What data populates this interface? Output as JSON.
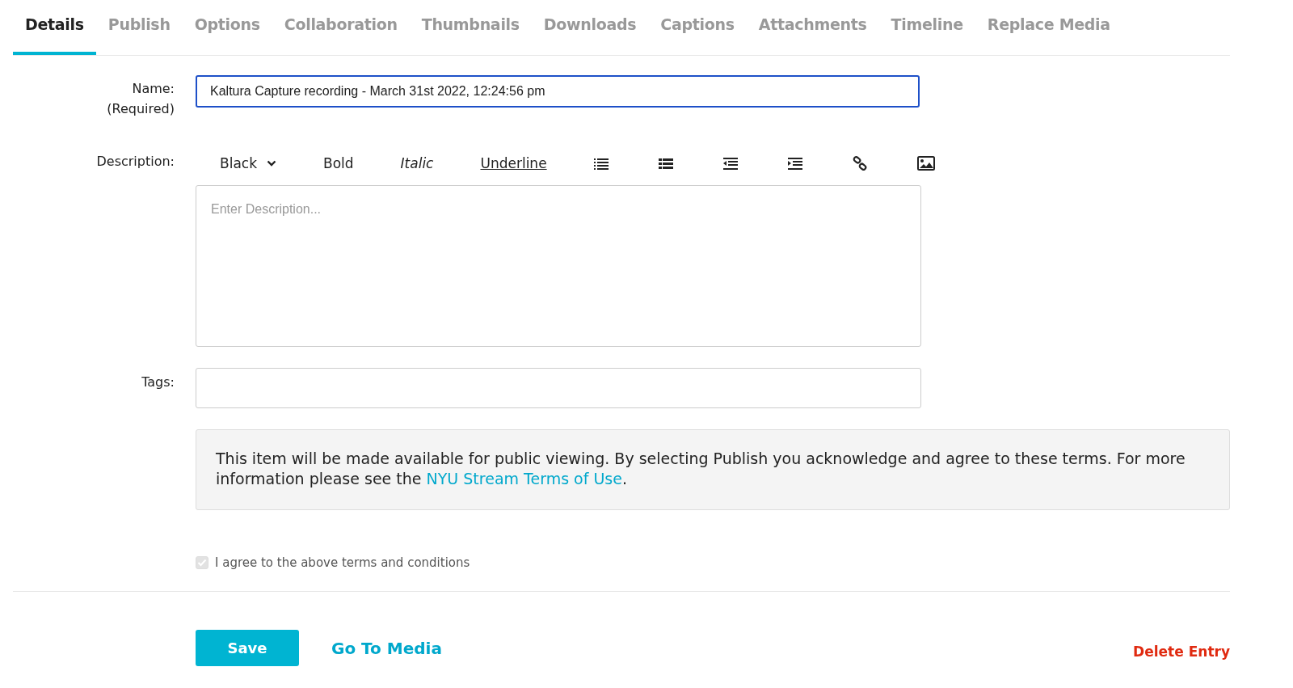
{
  "tabs": [
    {
      "label": "Details",
      "selected": true
    },
    {
      "label": "Publish",
      "selected": false
    },
    {
      "label": "Options",
      "selected": false
    },
    {
      "label": "Collaboration",
      "selected": false
    },
    {
      "label": "Thumbnails",
      "selected": false
    },
    {
      "label": "Downloads",
      "selected": false
    },
    {
      "label": "Captions",
      "selected": false
    },
    {
      "label": "Attachments",
      "selected": false
    },
    {
      "label": "Timeline",
      "selected": false
    },
    {
      "label": "Replace Media",
      "selected": false
    }
  ],
  "name_field": {
    "label": "Name:",
    "required": "(Required)",
    "value": "Kaltura Capture recording - March 31st 2022, 12:24:56 pm"
  },
  "description": {
    "label": "Description:",
    "placeholder": "Enter Description...",
    "toolbar": [
      {
        "kind": "color",
        "label": "Black"
      },
      {
        "kind": "bold",
        "label": "Bold"
      },
      {
        "kind": "italic",
        "label": "Italic"
      },
      {
        "kind": "underline",
        "label": "Underline"
      }
    ]
  },
  "tags": {
    "label": "Tags:"
  },
  "notice": {
    "text": "This item will be made available for public viewing. By selecting Publish you acknowledge and agree to these terms. For more information please see the ",
    "link": "NYU Stream Terms of Use",
    "after": "."
  },
  "agree": {
    "label": "I agree to the above terms and conditions",
    "checked": true,
    "disabled": true
  },
  "actions": {
    "save": "Save",
    "go_to_media": "Go To Media",
    "delete": "Delete Entry"
  }
}
